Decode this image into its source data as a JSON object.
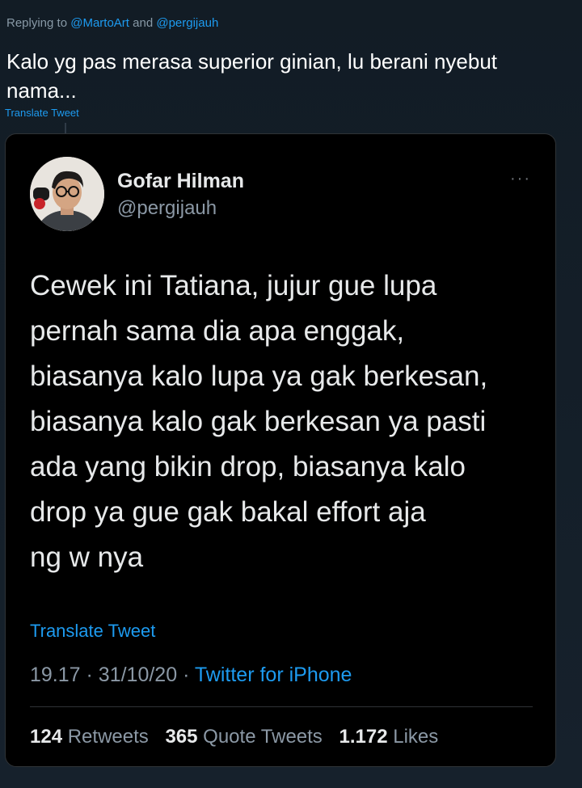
{
  "reply": {
    "prefix": "Replying to",
    "mention1": "@MartoArt",
    "and": "and",
    "mention2": "@pergijauh",
    "text": "Kalo yg pas merasa superior ginian, lu berani nyebut nama...",
    "translate": "Translate Tweet"
  },
  "quoted": {
    "display_name": "Gofar Hilman",
    "handle": "@pergijauh",
    "more": "···",
    "body": "Cewek ini Tatiana, jujur gue lupa\npernah sama dia apa enggak,\nbiasanya kalo lupa ya gak berkesan,\nbiasanya kalo gak berkesan ya pasti\nada yang bikin drop, biasanya kalo\ndrop ya gue gak bakal effort aja\nng  w  nya",
    "translate": "Translate Tweet",
    "time": "19.17",
    "dot1": "·",
    "date": "31/10/20",
    "dot2": "·",
    "source": "Twitter for iPhone",
    "retweets_count": "124",
    "retweets_label": "Retweets",
    "quotes_count": "365",
    "quotes_label": "Quote Tweets",
    "likes_count": "1.172",
    "likes_label": "Likes"
  },
  "colors": {
    "accent": "#1d9bf0",
    "background": "#15202b",
    "card": "#000000",
    "muted": "#8b98a5"
  }
}
